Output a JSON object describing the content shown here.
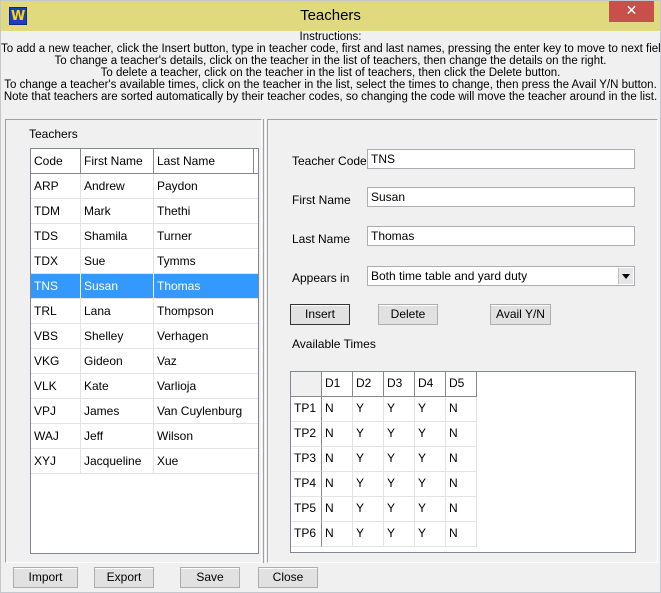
{
  "window": {
    "title": "Teachers",
    "close_label": "✕"
  },
  "instructions": {
    "heading": "Instructions:",
    "lines": [
      "To add a new teacher, click the Insert button, type in teacher code, first and last names, pressing the enter key to move to next field.",
      "To change a teacher's details, click on the teacher in the list of teachers, then change the details on the right.",
      "To delete a teacher, click on the teacher in the list of teachers, then click the Delete button.",
      "To change a teacher's available times, click on the teacher in the list, select the times to change, then press the Avail Y/N button.",
      "Note that teachers are sorted automatically by their teacher codes, so changing the code will move the teacher around in the list."
    ]
  },
  "teachers_panel": {
    "label": "Teachers",
    "columns": [
      "Code",
      "First Name",
      "Last Name"
    ],
    "rows": [
      [
        "ARP",
        "Andrew",
        "Paydon"
      ],
      [
        "TDM",
        "Mark",
        "Thethi"
      ],
      [
        "TDS",
        "Shamila",
        "Turner"
      ],
      [
        "TDX",
        "Sue",
        "Tymms"
      ],
      [
        "TNS",
        "Susan",
        "Thomas"
      ],
      [
        "TRL",
        "Lana",
        "Thompson"
      ],
      [
        "VBS",
        "Shelley",
        "Verhagen"
      ],
      [
        "VKG",
        "Gideon",
        "Vaz"
      ],
      [
        "VLK",
        "Kate",
        "Varlioja"
      ],
      [
        "VPJ",
        "James",
        "Van Cuylenburg"
      ],
      [
        "WAJ",
        "Jeff",
        "Wilson"
      ],
      [
        "XYJ",
        "Jacqueline",
        "Xue"
      ]
    ],
    "selected_index": 4
  },
  "form": {
    "teacher_code_label": "Teacher Code",
    "teacher_code_value": "TNS",
    "first_name_label": "First Name",
    "first_name_value": "Susan",
    "last_name_label": "Last Name",
    "last_name_value": "Thomas",
    "appears_in_label": "Appears in",
    "appears_in_value": "Both time table and yard duty",
    "insert_label": "Insert",
    "delete_label": "Delete",
    "avail_label": "Avail Y/N",
    "available_times_label": "Available Times"
  },
  "times": {
    "columns": [
      "D1",
      "D2",
      "D3",
      "D4",
      "D5"
    ],
    "rows": [
      {
        "label": "TP1",
        "values": [
          "N",
          "Y",
          "Y",
          "Y",
          "N"
        ]
      },
      {
        "label": "TP2",
        "values": [
          "N",
          "Y",
          "Y",
          "Y",
          "N"
        ]
      },
      {
        "label": "TP3",
        "values": [
          "N",
          "Y",
          "Y",
          "Y",
          "N"
        ]
      },
      {
        "label": "TP4",
        "values": [
          "N",
          "Y",
          "Y",
          "Y",
          "N"
        ]
      },
      {
        "label": "TP5",
        "values": [
          "N",
          "Y",
          "Y",
          "Y",
          "N"
        ]
      },
      {
        "label": "TP6",
        "values": [
          "N",
          "Y",
          "Y",
          "Y",
          "N"
        ]
      }
    ]
  },
  "bottom": {
    "import_label": "Import",
    "export_label": "Export",
    "save_label": "Save",
    "close_label": "Close"
  },
  "colors": {
    "titlebar": "#e0d97e",
    "selection": "#3399ff",
    "close_button": "#c7504b"
  }
}
